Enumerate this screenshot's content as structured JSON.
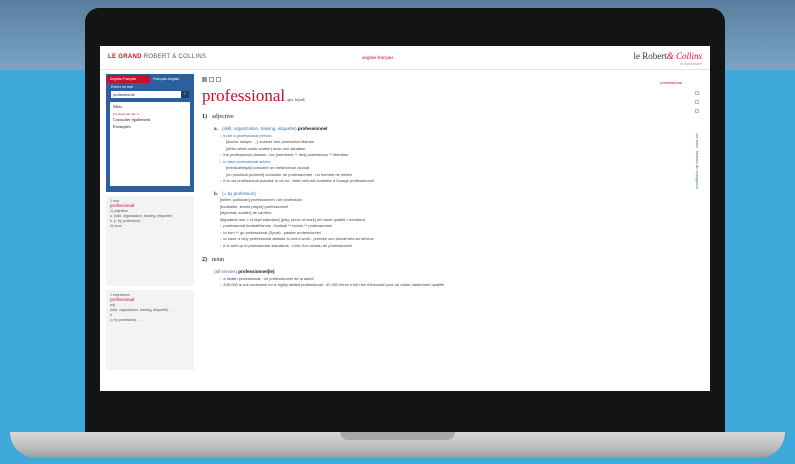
{
  "app": {
    "brand_prefix": "LE GRAND",
    "brand_name": "ROBERT & COLLINS",
    "center_link": "anglais-français",
    "logo_a": "le Robert",
    "logo_b": "& Collins",
    "logo_sub": "le dictionnaire"
  },
  "search": {
    "tab_active": "Anglais-Français",
    "tab_other": "Français-Anglais",
    "label": "Entrez un mot",
    "value": "professional",
    "results": [
      "Mots",
      "professional adj. n",
      "Consulter également",
      "Exemples"
    ]
  },
  "toc": {
    "header": "1 mot",
    "word": "professional",
    "items": [
      "1) adjective",
      "a. (skill, organization, training, etiquette)",
      "b. (= by profession)",
      "2) noun"
    ]
  },
  "toc2": {
    "header": "1 expression",
    "word": "professional",
    "items": [
      "adj.",
      "(skill, organization, training, etiquette) ...",
      "n",
      "(= by profession) ..."
    ]
  },
  "entry": {
    "right_label": "professional",
    "headword": "professional",
    "phonetic": "/prəˈfeʃənl/",
    "pos1_num": "1)",
    "pos1": "adjective",
    "a_label": "a.",
    "a_ind": "(skill, organization, training, etiquette)",
    "a_tr": "professionnel",
    "a_lines": [
      "to be a professional person",
      "[doctor, lawyer, ...] exercer une profession libérale",
      "[other white-collar worker] avoir une situation",
      "the professional classes : les [membres ** des] professions ** libérales",
      "to take professional advice",
      "[medical/legal] consulter un médecin/un avocat",
      "[on practical problem] consulter un professionnel : un homme de métier",
      "it is not professional practice to do so : faire cela est contraire à l'usage professionnel"
    ],
    "b_label": "b.",
    "b_ind": "(= by profession)",
    "b_lines": [
      "[writer, politician] professionnel • de profession",
      "[footballer, tennis player] professionnel",
      "[diplomat, soldier] de carrière",
      "(figurative use = of high standard) [play, piece of work] de haute qualité • excellent",
      "professional football/tennis : football ** tennis ** professionnel",
      "to turn ** go professional (Sport) : passer professionnel",
      "to have a very professional attitude to one's work : prendre son travail très au sérieux",
      "it is well up to professional standards : c'est d'un niveau de professionnel"
    ],
    "pos2_num": "2)",
    "pos2": "noun",
    "n_ind": "(all senses)",
    "n_tr": "professionnel(le)",
    "n_lines": [
      "a health professional : un professionnel de la santé",
      "£40,000 is not excessive for a highly skilled professional : 40 000 livres n'est rien d'excessif pour un cadre hautement qualifié"
    ]
  },
  "rightbar": {
    "vertical": "voir aussi · tableaux de conjugaison"
  }
}
